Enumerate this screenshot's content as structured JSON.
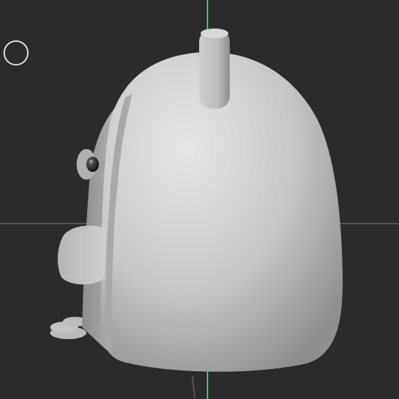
{
  "viewport": {
    "background": "#2b2b2b",
    "grid_axis_color": "#555555",
    "y_axis_color": "#3ad06a",
    "gizmo_color": "#e6e6e6"
  },
  "model": {
    "body_color": "#c9c9c9",
    "shadow_color": "#9a9a9a",
    "highlight_color": "#e3e3e3",
    "eye_color": "#1a1a1a"
  },
  "icons": {
    "gizmo": "circle-gizmo-icon"
  }
}
